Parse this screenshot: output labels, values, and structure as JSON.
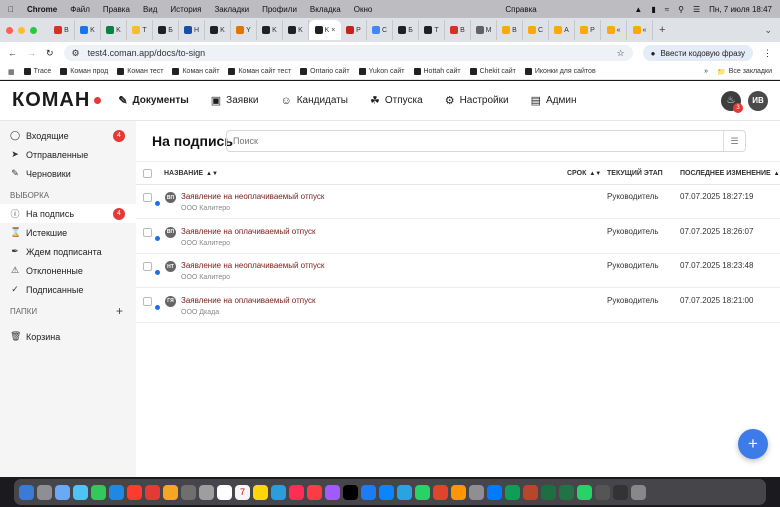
{
  "menubar": {
    "items": [
      "Chrome",
      "Файл",
      "Правка",
      "Вид",
      "История",
      "Закладки",
      "Профили",
      "Вкладка",
      "Окно"
    ],
    "help": "Справка",
    "datetime": "Пн, 7 июля 18:47"
  },
  "tabs": [
    {
      "letter": "B",
      "color": "#d93025"
    },
    {
      "letter": "K",
      "color": "#1a73e8"
    },
    {
      "letter": "K",
      "color": "#0b8043"
    },
    {
      "letter": "T",
      "color": "#f6bf26"
    },
    {
      "letter": "Б",
      "color": "#202124"
    },
    {
      "letter": "Н",
      "color": "#174ea6"
    },
    {
      "letter": "K",
      "color": "#202124"
    },
    {
      "letter": "Y",
      "color": "#e37400"
    },
    {
      "letter": "K",
      "color": "#202124"
    },
    {
      "letter": "K",
      "color": "#202124"
    },
    {
      "letter": "K",
      "color": "#202124",
      "active": true
    },
    {
      "letter": "P",
      "color": "#c5221f"
    },
    {
      "letter": "C",
      "color": "#4285f4"
    },
    {
      "letter": "Б",
      "color": "#202124"
    },
    {
      "letter": "T",
      "color": "#202124"
    },
    {
      "letter": "B",
      "color": "#d93025"
    },
    {
      "letter": "M",
      "color": "#5f6368"
    },
    {
      "letter": "B",
      "color": "#f9ab00"
    },
    {
      "letter": "C",
      "color": "#f9ab00"
    },
    {
      "letter": "A",
      "color": "#f9ab00"
    },
    {
      "letter": "P",
      "color": "#f9ab00"
    },
    {
      "letter": "«",
      "color": "#f9ab00"
    },
    {
      "letter": "«",
      "color": "#f9ab00"
    }
  ],
  "address": {
    "url": "test4.coman.app/docs/to-sign",
    "passphrase_label": "Ввести кодовую фразу"
  },
  "bookmarks": {
    "items": [
      "Trace",
      "Коман прод",
      "Коман тест",
      "Коман сайт",
      "Коман сайт тест",
      "Ontario сайт",
      "Yukon сайт",
      "Hottah сайт",
      "Chekit сайт",
      "Иконки для сайтов"
    ],
    "all": "Все закладки"
  },
  "app": {
    "logo": "КОМАН",
    "nav": [
      {
        "label": "Документы",
        "icon": "edit-icon",
        "active": true
      },
      {
        "label": "Заявки",
        "icon": "briefcase-icon"
      },
      {
        "label": "Кандидаты",
        "icon": "user-icon"
      },
      {
        "label": "Отпуска",
        "icon": "palm-icon"
      },
      {
        "label": "Настройки",
        "icon": "gear-icon"
      },
      {
        "label": "Админ",
        "icon": "card-icon"
      }
    ],
    "notifications_count": "3",
    "user_initials": "ИВ"
  },
  "sidebar": {
    "items": [
      {
        "label": "Входящие",
        "badge": "4"
      },
      {
        "label": "Отправленные"
      },
      {
        "label": "Черновики"
      }
    ],
    "section_selection": "ВЫБОРКА",
    "selection_items": [
      {
        "label": "На подпись",
        "badge": "4",
        "active": true
      },
      {
        "label": "Истекшие"
      },
      {
        "label": "Ждем подписанта"
      },
      {
        "label": "Отклоненные"
      },
      {
        "label": "Подписанные"
      }
    ],
    "section_folders": "ПАПКИ",
    "trash": "Корзина"
  },
  "main": {
    "title": "На подпись",
    "search_placeholder": "Поиск",
    "columns": {
      "name": "НАЗВАНИЕ",
      "deadline": "СРОК",
      "stage": "ТЕКУЩИЙ ЭТАП",
      "changed": "ПОСЛЕДНЕЕ ИЗМЕНЕНИЕ"
    },
    "rows": [
      {
        "initials": "ВП",
        "title": "Заявление на неоплачиваемый отпуск",
        "org": "ООО Калитеро",
        "stage": "Руководитель",
        "changed": "07.07.2025 18:27:19"
      },
      {
        "initials": "ВП",
        "title": "Заявление на оплачиваемый отпуск",
        "org": "ООО Калитеро",
        "stage": "Руководитель",
        "changed": "07.07.2025 18:26:07"
      },
      {
        "initials": "НТ",
        "title": "Заявление на неоплачиваемый отпуск",
        "org": "ООО Калитеро",
        "stage": "Руководитель",
        "changed": "07.07.2025 18:23:48"
      },
      {
        "initials": "ГЯ",
        "title": "Заявление на оплачиваемый отпуск",
        "org": "ООО Дкада",
        "stage": "Руководитель",
        "changed": "07.07.2025 18:21:00"
      }
    ]
  },
  "dock": {
    "calendar_day": "7",
    "apps": [
      "#3a7bd5",
      "#8e8e93",
      "#6aa9f5",
      "#4fc3f7",
      "#34c759",
      "#1e88e5",
      "#ff3b30",
      "#e53935",
      "#f5a623",
      "#6f6f6f",
      "#9e9e9e",
      "#ffffff",
      "#f5f5f5",
      "#ffd60a",
      "#2d9cdb",
      "#ff2d55",
      "#fc3c44",
      "#a259ff",
      "#000000",
      "#1c7cf4",
      "#0a84ff",
      "#2aa3e0",
      "#25d366",
      "#e0452b",
      "#ff9500",
      "#8e8e93",
      "#007aff",
      "#0f9d58",
      "#b7472a",
      "#1d6f42",
      "#217346",
      "#25d366",
      "#555555",
      "#333333",
      "#888888"
    ]
  }
}
